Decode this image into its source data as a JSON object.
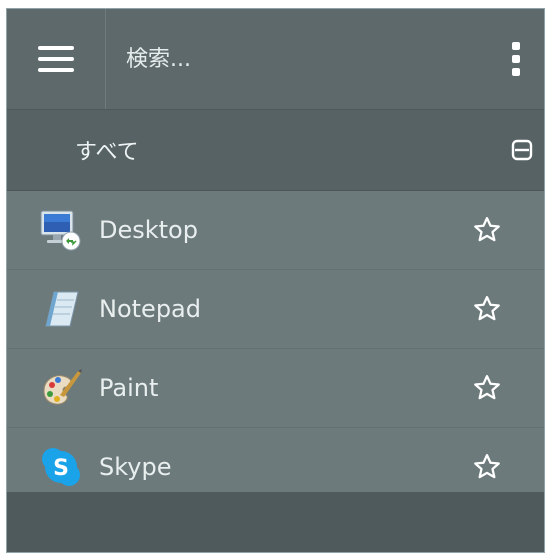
{
  "header": {
    "menu_icon": "hamburger-icon",
    "search_placeholder": "検索...",
    "more_icon": "kebab-menu-icon"
  },
  "filter": {
    "label": "すべて",
    "collapse_icon": "collapse-icon"
  },
  "apps": [
    {
      "name": "Desktop",
      "icon": "desktop-icon",
      "favorite_icon": "star-outline-icon"
    },
    {
      "name": "Notepad",
      "icon": "notepad-icon",
      "favorite_icon": "star-outline-icon"
    },
    {
      "name": "Paint",
      "icon": "paint-palette-icon",
      "favorite_icon": "star-outline-icon"
    },
    {
      "name": "Skype",
      "icon": "skype-icon",
      "favorite_icon": "star-outline-icon"
    }
  ],
  "colors": {
    "panel": "#5b6769",
    "list_background": "#6c7a7c",
    "skype_blue": "#1aa3e8"
  }
}
